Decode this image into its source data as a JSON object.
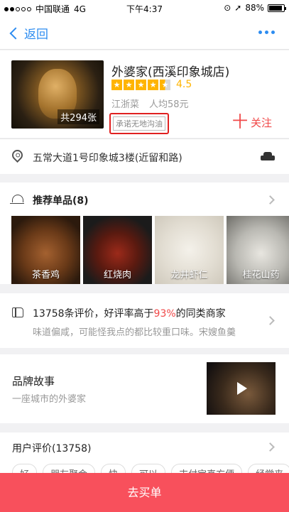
{
  "status_bar": {
    "carrier": "中国联通",
    "network": "4G",
    "time": "下午4:37",
    "battery": "88%",
    "battery_level": 0.88
  },
  "nav": {
    "back_label": "返回"
  },
  "shop": {
    "name": "外婆家(西溪印象城店)",
    "rating": "4.5",
    "stars": 4.5,
    "cuisine": "江浙菜",
    "avg_price": "人均58元",
    "photo_count": "共294张",
    "promise_tag": "承诺无地沟油",
    "follow_label": "关注",
    "follow_plus": "十",
    "address": "五常大道1号印象城3楼(近留和路)"
  },
  "recommend": {
    "title": "推荐单品(8)",
    "dishes": [
      {
        "name": "茶香鸡"
      },
      {
        "name": "红烧肉"
      },
      {
        "name": "龙井虾仁"
      },
      {
        "name": "桂花山药"
      }
    ]
  },
  "review_summary": {
    "count_text": "13758条评价，好评率高于",
    "percent": "93%",
    "suffix": "的同类商家",
    "snippet": "味道偏咸，可能怪我点的都比较重口味。宋嫂鱼羹"
  },
  "brand": {
    "title": "品牌故事",
    "subtitle": "一座城市的外婆家"
  },
  "user_review": {
    "title": "用户评价(13758)",
    "tags": [
      "好",
      "朋友聚会",
      "快",
      "可以",
      "支付宝真方便",
      "经常来"
    ]
  },
  "buy_button": {
    "label": "去买单"
  },
  "colors": {
    "accent": "#2d8cf0",
    "star": "#ffb400",
    "red": "#f04848",
    "buy": "#f8505c"
  }
}
